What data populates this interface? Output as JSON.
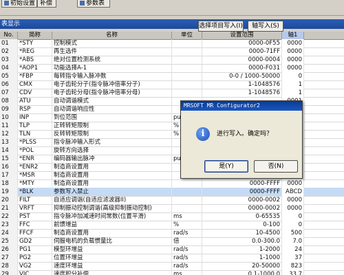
{
  "toolbar": {
    "buttons": [
      {
        "label": "初始设置"
      },
      {
        "label": "补偿"
      },
      {
        "label": "参数表"
      }
    ]
  },
  "panel": {
    "title": "表显示",
    "select_write_label": "选择项目写入(I)",
    "write_all_label": "轴写入(S)"
  },
  "table": {
    "headers": {
      "no": "No.",
      "abbr": "简称",
      "name": "名称",
      "unit": "单位",
      "range": "设置范围",
      "axis": "轴1"
    },
    "rows": [
      {
        "no": "01",
        "abbr": "*STY",
        "name": "控制模式",
        "unit": "",
        "range": "0000-0F55",
        "axis": "0000"
      },
      {
        "no": "02",
        "abbr": "*REG",
        "name": "再生选件",
        "unit": "",
        "range": "0000-71FF",
        "axis": "0000"
      },
      {
        "no": "03",
        "abbr": "*ABS",
        "name": "绝对位置检测系统",
        "unit": "",
        "range": "0000-0004",
        "axis": "0000"
      },
      {
        "no": "04",
        "abbr": "*AOP1",
        "name": "功能选择A-1",
        "unit": "",
        "range": "0000-F031",
        "axis": "0000"
      },
      {
        "no": "05",
        "abbr": "*FBP",
        "name": "每转指令输入脉冲数",
        "unit": "",
        "range": "0-0 / 1000-50000",
        "axis": "0"
      },
      {
        "no": "06",
        "abbr": "CMX",
        "name": "电子齿轮分子(指令脉冲倍率分子)",
        "unit": "",
        "range": "1-1048576",
        "axis": "1"
      },
      {
        "no": "07",
        "abbr": "CDV",
        "name": "电子齿轮分母(指令脉冲倍率分母)",
        "unit": "",
        "range": "1-1048576",
        "axis": "1"
      },
      {
        "no": "08",
        "abbr": "ATU",
        "name": "自动调谐模式",
        "unit": "",
        "range": "",
        "axis": "0001"
      },
      {
        "no": "09",
        "abbr": "RSP",
        "name": "自动调谐响应性",
        "unit": "",
        "range": "",
        "axis": ""
      },
      {
        "no": "10",
        "abbr": "INP",
        "name": "到位范围",
        "unit": "pul",
        "range": "",
        "axis": ""
      },
      {
        "no": "11",
        "abbr": "TLP",
        "name": "正转转矩限制",
        "unit": "%",
        "range": "",
        "axis": ""
      },
      {
        "no": "12",
        "abbr": "TLN",
        "name": "反转转矩限制",
        "unit": "%",
        "range": "",
        "axis": ""
      },
      {
        "no": "13",
        "abbr": "*PLSS",
        "name": "指令脉冲输入形式",
        "unit": "",
        "range": "",
        "axis": ""
      },
      {
        "no": "14",
        "abbr": "*POL",
        "name": "旋转方向选择",
        "unit": "",
        "range": "",
        "axis": ""
      },
      {
        "no": "15",
        "abbr": "*ENR",
        "name": "编码器输出脉冲",
        "unit": "pul",
        "range": "",
        "axis": ""
      },
      {
        "no": "16",
        "abbr": "*ENR2",
        "name": "制造商设置用",
        "unit": "",
        "range": "",
        "axis": ""
      },
      {
        "no": "17",
        "abbr": "*MSR",
        "name": "制造商设置用",
        "unit": "",
        "range": "",
        "axis": ""
      },
      {
        "no": "18",
        "abbr": "*MTY",
        "name": "制造商设置用",
        "unit": "",
        "range": "0000-FFFF",
        "axis": "0000"
      },
      {
        "no": "19",
        "abbr": "*BLK",
        "name": "参数写入禁止",
        "unit": "",
        "range": "0000-FFFF",
        "axis": "ABCD"
      },
      {
        "no": "20",
        "abbr": "FILT",
        "name": "自适应调谐(自适应滤波器II)",
        "unit": "",
        "range": "0000-0002",
        "axis": "0000"
      },
      {
        "no": "21",
        "abbr": "VRFT",
        "name": "抑制振动控制调谐(高级抑制振动控制)",
        "unit": "",
        "range": "0000-0002",
        "axis": "0000"
      },
      {
        "no": "22",
        "abbr": "PST",
        "name": "指令脉冲加减速时间常数(位置平滑)",
        "unit": "ms",
        "range": "0-65535",
        "axis": "0"
      },
      {
        "no": "23",
        "abbr": "FFC",
        "name": "前馈增益",
        "unit": "%",
        "range": "0-100",
        "axis": "0"
      },
      {
        "no": "24",
        "abbr": "FFCF",
        "name": "制造商设置用",
        "unit": "rad/s",
        "range": "10-4500",
        "axis": "500"
      },
      {
        "no": "25",
        "abbr": "GD2",
        "name": "伺服电机的负载惯量比",
        "unit": "倍",
        "range": "0.0-300.0",
        "axis": "7.0"
      },
      {
        "no": "26",
        "abbr": "PG1",
        "name": "模型环增益",
        "unit": "rad/s",
        "range": "1-2000",
        "axis": "24"
      },
      {
        "no": "27",
        "abbr": "PG2",
        "name": "位置环增益",
        "unit": "rad/s",
        "range": "1-1000",
        "axis": "37"
      },
      {
        "no": "28",
        "abbr": "VG2",
        "name": "速度环增益",
        "unit": "rad/s",
        "range": "20-50000",
        "axis": "823"
      },
      {
        "no": "29",
        "abbr": "VIC",
        "name": "速度积分补偿",
        "unit": "ms",
        "range": "0.1-1000.0",
        "axis": "33.7"
      }
    ]
  },
  "dialog": {
    "title": "MRSOFT MR Configurator2",
    "icon": "info-icon",
    "icon_glyph": "i",
    "message": "进行写入。确定吗？",
    "yes_label": "是(Y)",
    "no_label": "否(N)"
  },
  "colors": {
    "title_bar": "#1d4a9c",
    "selected_row": "#c5dbf5",
    "dialog_title": "#0b3c8f"
  }
}
